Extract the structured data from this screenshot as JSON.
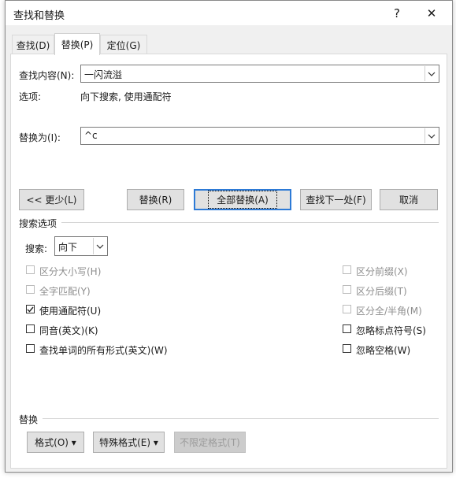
{
  "window": {
    "title": "查找和替换",
    "help_label": "?",
    "close_label": "✕"
  },
  "tabs": [
    {
      "label": "查找(D)"
    },
    {
      "label": "替换(P)"
    },
    {
      "label": "定位(G)"
    }
  ],
  "find": {
    "label": "查找内容(N):",
    "value": "一闪流溢",
    "options_label": "选项:",
    "options_value": "向下搜索, 使用通配符"
  },
  "replace": {
    "label": "替换为(I):",
    "value": "^c"
  },
  "buttons": {
    "less": "<< 更少(L)",
    "replace": "替换(R)",
    "replace_all": "全部替换(A)",
    "find_next": "查找下一处(F)",
    "cancel": "取消"
  },
  "search_options": {
    "heading": "搜索选项",
    "search_label": "搜索:",
    "direction": "向下",
    "left_checks": [
      {
        "label": "区分大小写(H)",
        "checked": false,
        "enabled": false
      },
      {
        "label": "全字匹配(Y)",
        "checked": false,
        "enabled": false
      },
      {
        "label": "使用通配符(U)",
        "checked": true,
        "enabled": true
      },
      {
        "label": "同音(英文)(K)",
        "checked": false,
        "enabled": true
      },
      {
        "label": "查找单词的所有形式(英文)(W)",
        "checked": false,
        "enabled": true
      }
    ],
    "right_checks": [
      {
        "label": "区分前缀(X)",
        "checked": false,
        "enabled": false
      },
      {
        "label": "区分后缀(T)",
        "checked": false,
        "enabled": false
      },
      {
        "label": "区分全/半角(M)",
        "checked": false,
        "enabled": false
      },
      {
        "label": "忽略标点符号(S)",
        "checked": false,
        "enabled": true
      },
      {
        "label": "忽略空格(W)",
        "checked": false,
        "enabled": true
      }
    ]
  },
  "replace_section": {
    "heading": "替换",
    "format_btn": "格式(O) ▾",
    "special_btn": "特殊格式(E) ▾",
    "no_format_btn": "不限定格式(T)"
  }
}
